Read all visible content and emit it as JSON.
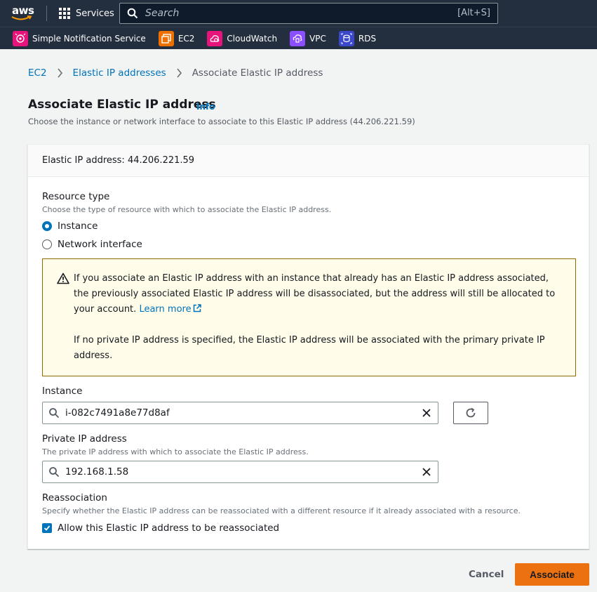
{
  "topnav": {
    "logo_text": "aws",
    "services_label": "Services",
    "search_placeholder": "Search",
    "search_shortcut": "[Alt+S]"
  },
  "favorites": [
    {
      "label": "Simple Notification Service",
      "color": "#e7157b",
      "icon": "sns-icon"
    },
    {
      "label": "EC2",
      "color": "#ed7100",
      "icon": "ec2-icon"
    },
    {
      "label": "CloudWatch",
      "color": "#e7157b",
      "icon": "cloudwatch-icon"
    },
    {
      "label": "VPC",
      "color": "#8c4fff",
      "icon": "vpc-icon"
    },
    {
      "label": "RDS",
      "color": "#3b48cc",
      "icon": "rds-icon"
    }
  ],
  "breadcrumb": {
    "items": [
      "EC2",
      "Elastic IP addresses"
    ],
    "current": "Associate Elastic IP address"
  },
  "header": {
    "title": "Associate Elastic IP address",
    "info": "Info",
    "description": "Choose the instance or network interface to associate to this Elastic IP address (44.206.221.59)"
  },
  "panel": {
    "header": "Elastic IP address: 44.206.221.59",
    "resource_type": {
      "label": "Resource type",
      "description": "Choose the type of resource with which to associate the Elastic IP address.",
      "options": [
        "Instance",
        "Network interface"
      ],
      "selected": "Instance"
    },
    "alert": {
      "text1": "If you associate an Elastic IP address with an instance that already has an Elastic IP address associated, the previously associated Elastic IP address will be disassociated, but the address will still be allocated to your account.",
      "link": "Learn more",
      "text2": "If no private IP address is specified, the Elastic IP address will be associated with the primary private IP address."
    },
    "instance": {
      "label": "Instance",
      "value": "i-082c7491a8e77d8af"
    },
    "private_ip": {
      "label": "Private IP address",
      "description": "The private IP address with which to associate the Elastic IP address.",
      "value": "192.168.1.58"
    },
    "reassociation": {
      "label": "Reassociation",
      "description": "Specify whether the Elastic IP address can be reassociated with a different resource if it already associated with a resource.",
      "checkbox_label": "Allow this Elastic IP address to be reassociated",
      "checked": true
    }
  },
  "footer": {
    "cancel": "Cancel",
    "submit": "Associate"
  },
  "colors": {
    "nav_bg": "#232f3e",
    "link": "#0073bb",
    "primary_button": "#ec7211",
    "alert_bg": "#fffce9",
    "alert_border": "#8e6a00"
  }
}
